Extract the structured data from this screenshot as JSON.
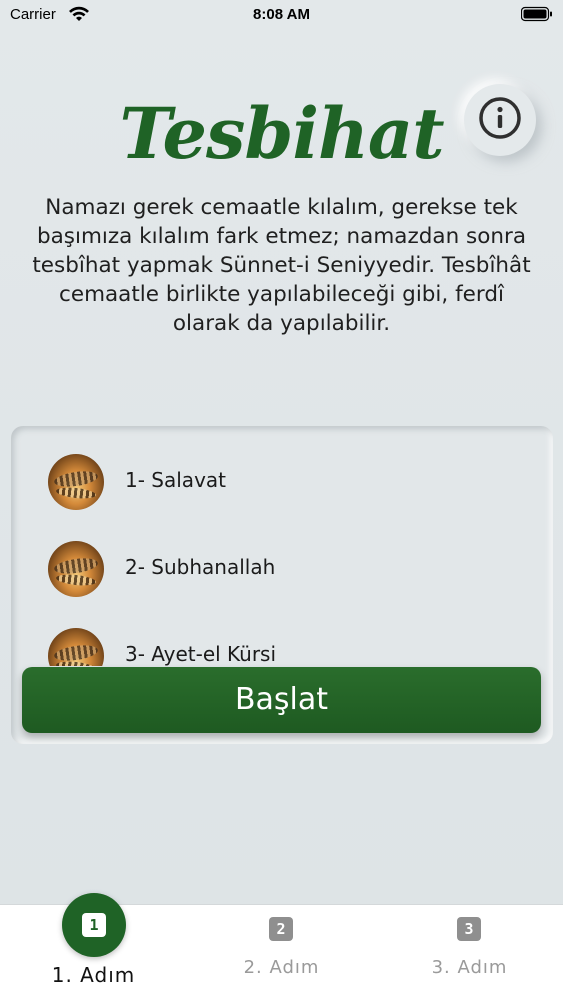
{
  "status_bar": {
    "carrier": "Carrier",
    "time": "8:08 AM"
  },
  "app": {
    "title": "Tesbihat",
    "description": "Namazı gerek cemaatle kılalım, gerekse tek başımıza kılalım fark etmez; namazdan sonra tesbîhat yapmak Sünnet-i Seniyyedir. Tesbîhât cemaatle birlikte yapılabileceği gibi, ferdî olarak da yapılabilir."
  },
  "list": {
    "items": [
      {
        "label": "1- Salavat"
      },
      {
        "label": "2- Subhanallah"
      },
      {
        "label": "3- Ayet-el Kürsi"
      }
    ]
  },
  "start_button": {
    "label": "Başlat"
  },
  "tabs": [
    {
      "label": "1. Adım",
      "icon": "1"
    },
    {
      "label": "2. Adım",
      "icon": "2"
    },
    {
      "label": "3. Adım",
      "icon": "3"
    }
  ],
  "colors": {
    "accent": "#1f6326",
    "background": "#e1e6e8"
  }
}
